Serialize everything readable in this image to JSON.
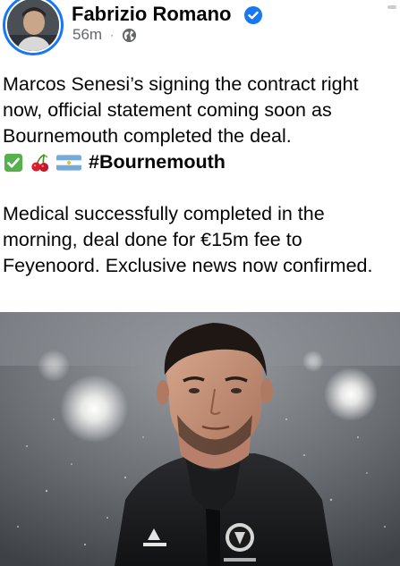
{
  "post": {
    "author": "Fabrizio Romano",
    "time": "56m",
    "separator": "·",
    "privacy_icon": "globe-icon",
    "verified_icon": "verified-badge-icon",
    "paragraph1": "Marcos Senesi’s signing the contract right now, official statement coming soon as Bournemouth completed the deal.",
    "emojis": [
      "check-mark-emoji",
      "cherries-emoji",
      "argentina-flag-emoji"
    ],
    "hashtag": "#Bournemouth",
    "paragraph2": "Medical successfully completed in the morning, deal done for €15m fee to Feyenoord. Exclusive news now confirmed.",
    "image_description_icon": "player-photo"
  },
  "colors": {
    "accent": "#1877f2",
    "meta_text": "#65676b",
    "body_text": "#050505"
  }
}
